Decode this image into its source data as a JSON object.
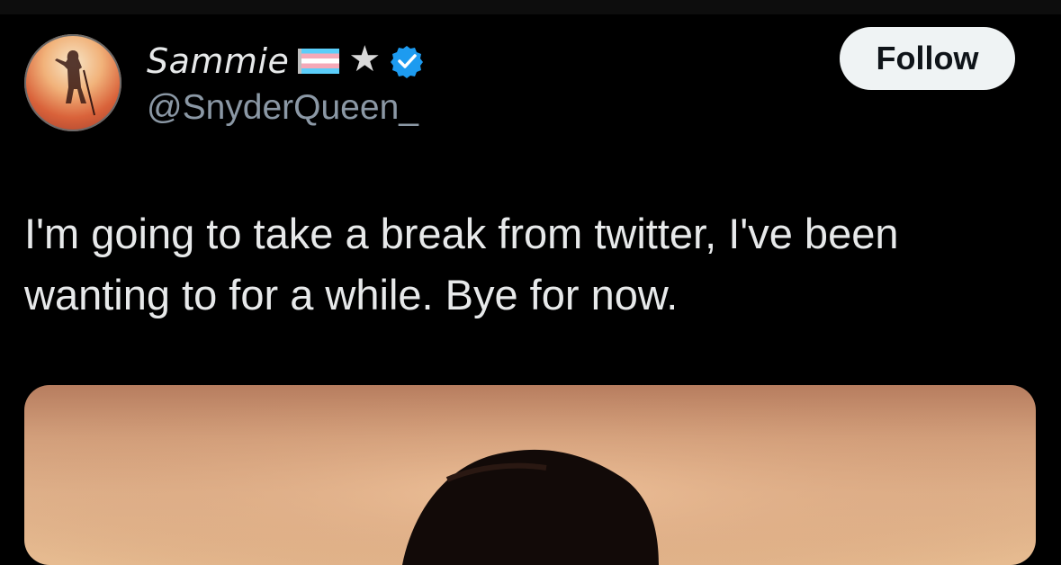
{
  "author": {
    "display_name": "Sammie",
    "handle": "@SnyderQueen_",
    "badges": [
      "transgender-flag-icon",
      "star-icon",
      "verified-icon"
    ],
    "avatar_icon": "avatar-wonder-woman-silhouette"
  },
  "actions": {
    "follow_label": "Follow"
  },
  "tweet": {
    "text": "I'm going to take a break from twitter, I've been wanting to for a while. Bye for now."
  },
  "colors": {
    "background": "#000000",
    "primary_text": "#e7e9ea",
    "secondary_text": "#8b98a5",
    "verified_blue": "#1d9bf0",
    "follow_button_bg": "#eff3f4"
  }
}
